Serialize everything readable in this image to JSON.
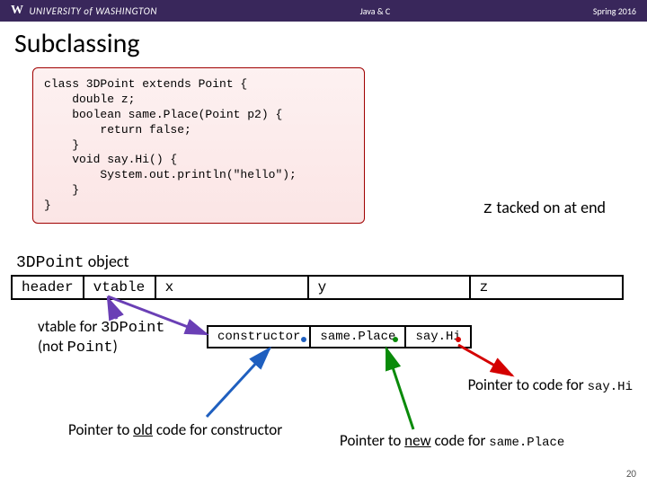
{
  "header": {
    "logo_w": "W",
    "logo_text": "UNIVERSITY of WASHINGTON",
    "center": "Java & C",
    "right": "Spring 2016"
  },
  "title": "Subclassing",
  "code": "class 3DPoint extends Point {\n    double z;\n    boolean same.Place(Point p2) {\n        return false;\n    }\n    void say.Hi() {\n        System.out.println(\"hello\");\n    }\n}",
  "tacked": {
    "z": "z",
    "rest": " tacked on at end"
  },
  "obj_label": {
    "mono": "3DPoint",
    "rest": " object"
  },
  "layout": {
    "header": "header",
    "vtable": "vtable",
    "x": "x",
    "y": "y",
    "z": "z"
  },
  "vtable_caption": {
    "line1_a": "vtable for ",
    "line1_b": "3DPoint",
    "line2_a": "(not ",
    "line2_b": "Point",
    "line2_c": ")"
  },
  "vtable_cells": {
    "c1": "constructor",
    "c2": "same.Place",
    "c3": "say.Hi"
  },
  "note1": {
    "a": "Pointer to code for ",
    "b": "say.Hi"
  },
  "note2": {
    "a": "Pointer to ",
    "b": "old",
    "c": " code for constructor"
  },
  "note3": {
    "a": "Pointer to ",
    "b": "new",
    "c": " code for ",
    "d": "same.Place"
  },
  "page_num": "20"
}
